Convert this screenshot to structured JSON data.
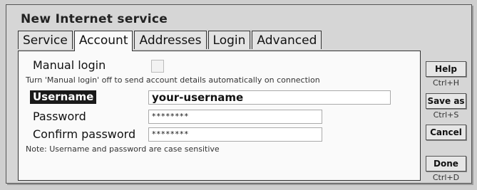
{
  "window": {
    "title": "New Internet service"
  },
  "tabs": [
    {
      "label": "Service"
    },
    {
      "label": "Account"
    },
    {
      "label": "Addresses"
    },
    {
      "label": "Login"
    },
    {
      "label": "Advanced"
    }
  ],
  "active_tab": "Account",
  "account": {
    "manual_login_label": "Manual login",
    "manual_login_checked": false,
    "manual_login_hint": "Turn 'Manual login' off to send account details automatically on connection",
    "username_label": "Username",
    "username_value": "your-username",
    "password_label": "Password",
    "password_value": "********",
    "confirm_label": "Confirm password",
    "confirm_value": "********",
    "note": "Note: Username and password are case sensitive"
  },
  "buttons": {
    "help": {
      "label": "Help",
      "shortcut": "Ctrl+H"
    },
    "save_as": {
      "label": "Save as",
      "shortcut": "Ctrl+S"
    },
    "cancel": {
      "label": "Cancel"
    },
    "done": {
      "label": "Done",
      "shortcut": "Ctrl+D"
    }
  },
  "colors": {
    "selection": "#1a1a1a",
    "panel": "#fafafa",
    "dialog": "#d6d6d6"
  }
}
